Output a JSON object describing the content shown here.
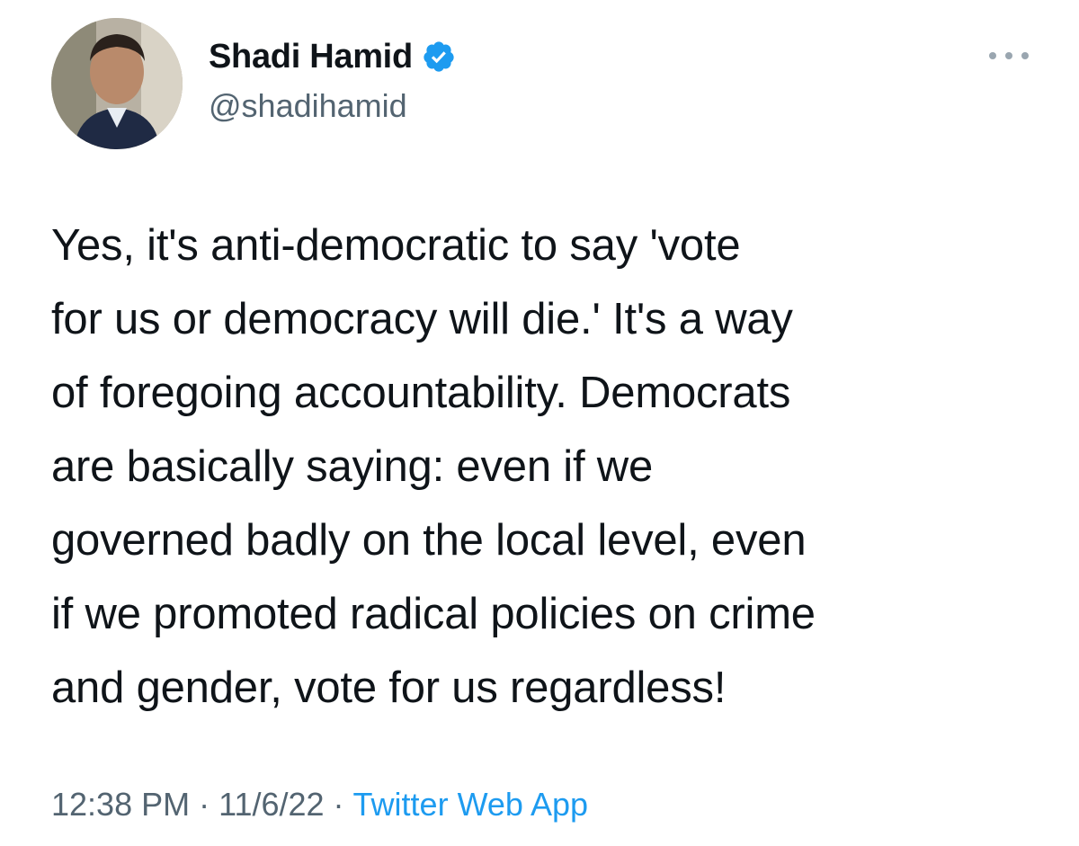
{
  "author": {
    "display_name": "Shadi Hamid",
    "handle": "@shadihamid",
    "verified": true,
    "verified_icon": "verified-badge-icon",
    "avatar_icon": "profile-photo"
  },
  "tweet": {
    "text_lines": [
      "Yes, it's anti-democratic to say 'vote",
      "for us or democracy will die.' It's a way",
      "of foregoing accountability. Democrats",
      "are basically saying: even if we",
      "governed badly on the local level, even",
      "if we promoted radical policies on crime",
      "and gender, vote for us regardless!"
    ],
    "time": "12:38 PM",
    "date": "11/6/22",
    "separator": "·",
    "source": "Twitter Web App"
  },
  "menu": {
    "icon": "more-options-icon"
  },
  "colors": {
    "accent": "#1d9bf0",
    "text": "#0f1419",
    "muted": "#536471"
  }
}
